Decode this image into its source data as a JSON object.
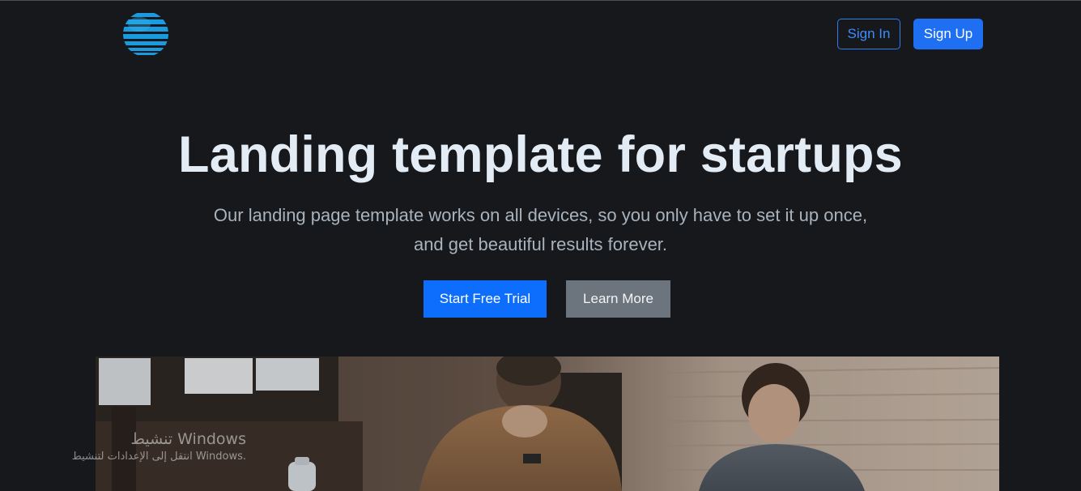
{
  "header": {
    "logo_icon": "globe-logo-icon",
    "sign_in_label": "Sign In",
    "sign_up_label": "Sign Up"
  },
  "hero": {
    "title": "Landing template for startups",
    "subtitle_line1": "Our landing page template works on all devices, so you only have to set it up once,",
    "subtitle_line2": "and get beautiful results forever.",
    "start_trial_label": "Start Free Trial",
    "learn_more_label": "Learn More"
  },
  "watermark": {
    "title": "تنشيط Windows",
    "subtitle": "انتقل إلى الإعدادات لتنشيط Windows."
  },
  "colors": {
    "background": "#16181b",
    "primary": "#0d6efd",
    "secondary": "#6c757d",
    "logo_blue": "#1a9be0"
  }
}
